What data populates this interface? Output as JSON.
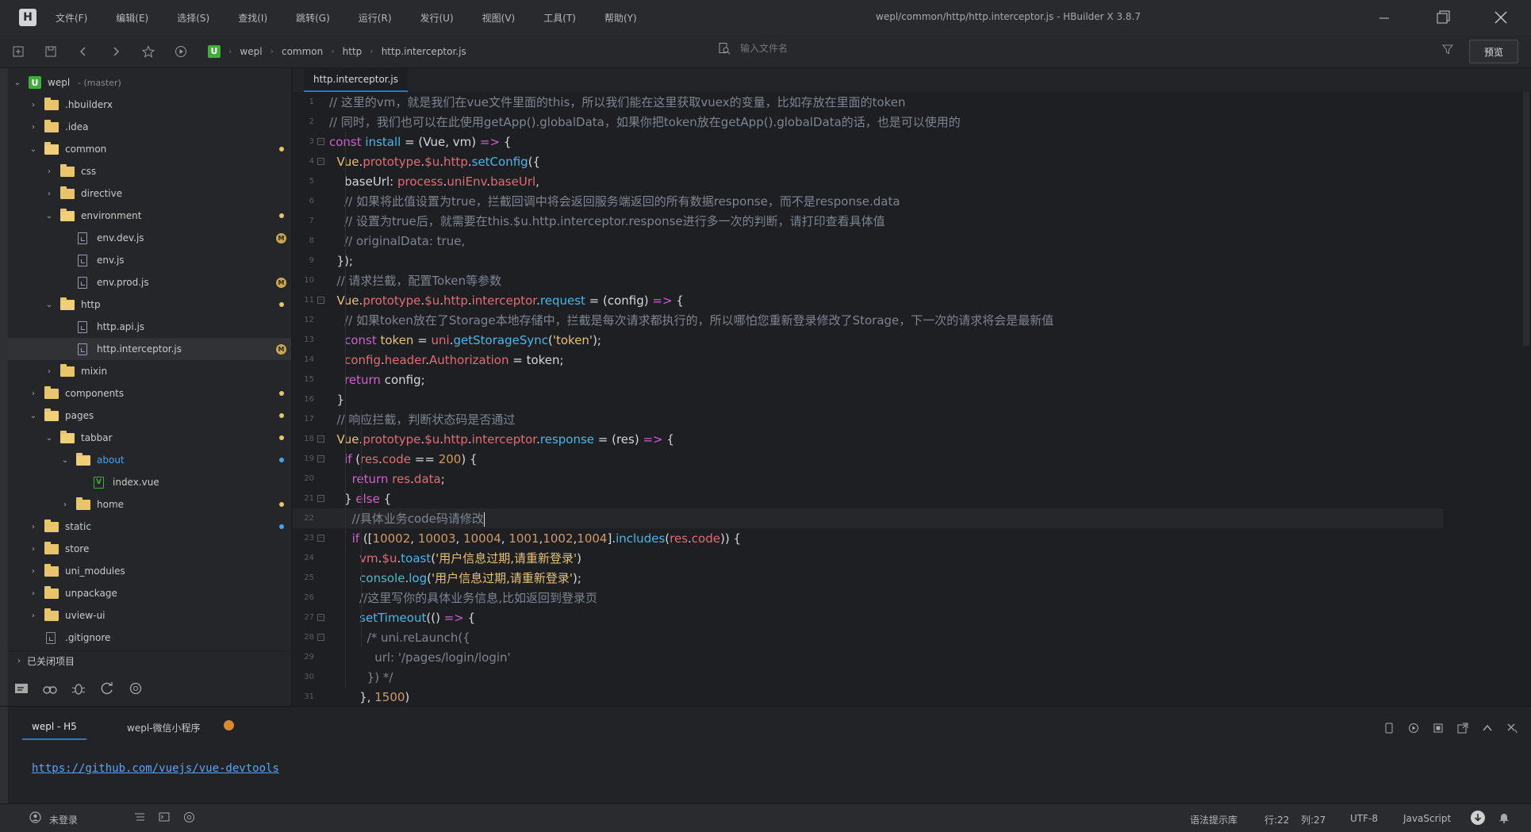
{
  "app": {
    "logo": "H",
    "window_title": "wepl/common/http/http.interceptor.js - HBuilder X 3.8.7"
  },
  "menu": [
    "文件(F)",
    "编辑(E)",
    "选择(S)",
    "查找(I)",
    "跳转(G)",
    "运行(R)",
    "发行(U)",
    "视图(V)",
    "工具(T)",
    "帮助(Y)"
  ],
  "toolbar": {
    "breadcrumb": [
      "wepl",
      "common",
      "http",
      "http.interceptor.js"
    ],
    "file_search_placeholder": "输入文件名",
    "preview_label": "预览"
  },
  "sidebar": {
    "project": {
      "name": "wepl",
      "branch": "- (master)"
    },
    "items": [
      {
        "label": ".hbuilderx",
        "type": "folder",
        "depth": 1,
        "expanded": false,
        "marker": ""
      },
      {
        "label": ".idea",
        "type": "folder",
        "depth": 1,
        "expanded": false,
        "marker": ""
      },
      {
        "label": "common",
        "type": "folder",
        "depth": 1,
        "expanded": true,
        "marker": "dot"
      },
      {
        "label": "css",
        "type": "folder",
        "depth": 2,
        "expanded": false,
        "marker": ""
      },
      {
        "label": "directive",
        "type": "folder",
        "depth": 2,
        "expanded": false,
        "marker": ""
      },
      {
        "label": "environment",
        "type": "folder",
        "depth": 2,
        "expanded": true,
        "marker": "dot"
      },
      {
        "label": "env.dev.js",
        "type": "js",
        "depth": 3,
        "marker": "M"
      },
      {
        "label": "env.js",
        "type": "js",
        "depth": 3,
        "marker": ""
      },
      {
        "label": "env.prod.js",
        "type": "js",
        "depth": 3,
        "marker": "M"
      },
      {
        "label": "http",
        "type": "folder",
        "depth": 2,
        "expanded": true,
        "marker": "dot"
      },
      {
        "label": "http.api.js",
        "type": "js",
        "depth": 3,
        "marker": ""
      },
      {
        "label": "http.interceptor.js",
        "type": "js",
        "depth": 3,
        "marker": "M",
        "selected": true
      },
      {
        "label": "mixin",
        "type": "folder",
        "depth": 2,
        "expanded": false,
        "marker": ""
      },
      {
        "label": "components",
        "type": "folder",
        "depth": 1,
        "expanded": false,
        "marker": "dot"
      },
      {
        "label": "pages",
        "type": "folder",
        "depth": 1,
        "expanded": true,
        "marker": "dot"
      },
      {
        "label": "tabbar",
        "type": "folder",
        "depth": 2,
        "expanded": true,
        "marker": "dot"
      },
      {
        "label": "about",
        "type": "folder",
        "depth": 3,
        "expanded": true,
        "marker": "dot-blue",
        "highlight": true
      },
      {
        "label": "index.vue",
        "type": "vue",
        "depth": 4,
        "marker": ""
      },
      {
        "label": "home",
        "type": "folder",
        "depth": 3,
        "expanded": false,
        "marker": "dot"
      },
      {
        "label": "static",
        "type": "folder",
        "depth": 1,
        "expanded": false,
        "marker": "dot-blue"
      },
      {
        "label": "store",
        "type": "folder",
        "depth": 1,
        "expanded": false,
        "marker": ""
      },
      {
        "label": "uni_modules",
        "type": "folder",
        "depth": 1,
        "expanded": false,
        "marker": ""
      },
      {
        "label": "unpackage",
        "type": "folder",
        "depth": 1,
        "expanded": false,
        "marker": ""
      },
      {
        "label": "uview-ui",
        "type": "folder",
        "depth": 1,
        "expanded": false,
        "marker": ""
      },
      {
        "label": ".gitignore",
        "type": "file",
        "depth": 1,
        "marker": ""
      }
    ],
    "closed_projects": "已关闭项目"
  },
  "editor": {
    "tab_label": "http.interceptor.js",
    "cursor_line": 22,
    "lines": [
      {
        "n": "1",
        "fold": false,
        "segs": [
          [
            "cm",
            "// 这里的vm，就是我们在vue文件里面的this，所以我们能在这里获取vuex的变量，比如存放在里面的token"
          ]
        ]
      },
      {
        "n": "2",
        "fold": false,
        "segs": [
          [
            "cm",
            "// 同时，我们也可以在此使用getApp().globalData，如果你把token放在getApp().globalData的话，也是可以使用的"
          ]
        ]
      },
      {
        "n": "3",
        "fold": true,
        "segs": [
          [
            "kw",
            "const "
          ],
          [
            "fn",
            "install"
          ],
          [
            "tx",
            " = (Vue, vm) "
          ],
          [
            "kw",
            "=>"
          ],
          [
            "tx",
            " {"
          ]
        ]
      },
      {
        "n": "4",
        "fold": true,
        "segs": [
          [
            "tx",
            "  "
          ],
          [
            "yl",
            "Vue"
          ],
          [
            "tx",
            "."
          ],
          [
            "pr",
            "prototype"
          ],
          [
            "tx",
            "."
          ],
          [
            "pr",
            "$u"
          ],
          [
            "tx",
            "."
          ],
          [
            "pr",
            "http"
          ],
          [
            "tx",
            "."
          ],
          [
            "fn",
            "setConfig"
          ],
          [
            "tx",
            "({"
          ]
        ]
      },
      {
        "n": "5",
        "fold": false,
        "segs": [
          [
            "tx",
            "    baseUrl: "
          ],
          [
            "pr",
            "process"
          ],
          [
            "tx",
            "."
          ],
          [
            "pr",
            "uniEnv"
          ],
          [
            "tx",
            "."
          ],
          [
            "pr",
            "baseUrl"
          ],
          [
            "tx",
            ","
          ]
        ]
      },
      {
        "n": "6",
        "fold": false,
        "segs": [
          [
            "cm",
            "    // 如果将此值设置为true，拦截回调中将会返回服务端返回的所有数据response，而不是response.data"
          ]
        ]
      },
      {
        "n": "7",
        "fold": false,
        "segs": [
          [
            "cm",
            "    // 设置为true后，就需要在this.$u.http.interceptor.response进行多一次的判断，请打印查看具体值"
          ]
        ]
      },
      {
        "n": "8",
        "fold": false,
        "segs": [
          [
            "cm",
            "    // originalData: true,"
          ]
        ]
      },
      {
        "n": "9",
        "fold": false,
        "segs": [
          [
            "tx",
            "  });"
          ]
        ]
      },
      {
        "n": "10",
        "fold": false,
        "segs": [
          [
            "cm",
            "  // 请求拦截，配置Token等参数"
          ]
        ]
      },
      {
        "n": "11",
        "fold": true,
        "segs": [
          [
            "tx",
            "  "
          ],
          [
            "yl",
            "Vue"
          ],
          [
            "tx",
            "."
          ],
          [
            "pr",
            "prototype"
          ],
          [
            "tx",
            "."
          ],
          [
            "pr",
            "$u"
          ],
          [
            "tx",
            "."
          ],
          [
            "pr",
            "http"
          ],
          [
            "tx",
            "."
          ],
          [
            "pr",
            "interceptor"
          ],
          [
            "tx",
            "."
          ],
          [
            "fn",
            "request"
          ],
          [
            "tx",
            " = (config) "
          ],
          [
            "kw",
            "=>"
          ],
          [
            "tx",
            " {"
          ]
        ]
      },
      {
        "n": "12",
        "fold": false,
        "segs": [
          [
            "cm",
            "    // 如果token放在了Storage本地存储中，拦截是每次请求都执行的，所以哪怕您重新登录修改了Storage，下一次的请求将会是最新值"
          ]
        ]
      },
      {
        "n": "13",
        "fold": false,
        "segs": [
          [
            "tx",
            "    "
          ],
          [
            "kw",
            "const "
          ],
          [
            "yl",
            "token"
          ],
          [
            "tx",
            " = "
          ],
          [
            "pr",
            "uni"
          ],
          [
            "tx",
            "."
          ],
          [
            "fn",
            "getStorageSync"
          ],
          [
            "tx",
            "("
          ],
          [
            "st",
            "'token'"
          ],
          [
            "tx",
            ");"
          ]
        ]
      },
      {
        "n": "14",
        "fold": false,
        "segs": [
          [
            "tx",
            "    "
          ],
          [
            "pr",
            "config"
          ],
          [
            "tx",
            "."
          ],
          [
            "pr",
            "header"
          ],
          [
            "tx",
            "."
          ],
          [
            "pr",
            "Authorization"
          ],
          [
            "tx",
            " = token;"
          ]
        ]
      },
      {
        "n": "15",
        "fold": false,
        "segs": [
          [
            "tx",
            "    "
          ],
          [
            "kw",
            "return "
          ],
          [
            "tx",
            "config;"
          ]
        ]
      },
      {
        "n": "16",
        "fold": false,
        "segs": [
          [
            "tx",
            "  }"
          ]
        ]
      },
      {
        "n": "17",
        "fold": false,
        "segs": [
          [
            "cm",
            "  // 响应拦截，判断状态码是否通过"
          ]
        ]
      },
      {
        "n": "18",
        "fold": true,
        "segs": [
          [
            "tx",
            "  "
          ],
          [
            "yl",
            "Vue"
          ],
          [
            "tx",
            "."
          ],
          [
            "pr",
            "prototype"
          ],
          [
            "tx",
            "."
          ],
          [
            "pr",
            "$u"
          ],
          [
            "tx",
            "."
          ],
          [
            "pr",
            "http"
          ],
          [
            "tx",
            "."
          ],
          [
            "pr",
            "interceptor"
          ],
          [
            "tx",
            "."
          ],
          [
            "fn",
            "response"
          ],
          [
            "tx",
            " = (res) "
          ],
          [
            "kw",
            "=>"
          ],
          [
            "tx",
            " {"
          ]
        ]
      },
      {
        "n": "19",
        "fold": true,
        "segs": [
          [
            "tx",
            "    "
          ],
          [
            "kw",
            "if"
          ],
          [
            "tx",
            " ("
          ],
          [
            "pr",
            "res"
          ],
          [
            "tx",
            "."
          ],
          [
            "pr",
            "code"
          ],
          [
            "tx",
            " == "
          ],
          [
            "nm",
            "200"
          ],
          [
            "tx",
            ") {"
          ]
        ]
      },
      {
        "n": "20",
        "fold": false,
        "segs": [
          [
            "tx",
            "      "
          ],
          [
            "kw",
            "return "
          ],
          [
            "pr",
            "res"
          ],
          [
            "tx",
            "."
          ],
          [
            "pr",
            "data"
          ],
          [
            "tx",
            ";"
          ]
        ]
      },
      {
        "n": "21",
        "fold": true,
        "segs": [
          [
            "tx",
            "    } "
          ],
          [
            "kw",
            "else"
          ],
          [
            "tx",
            " {"
          ]
        ]
      },
      {
        "n": "22",
        "fold": false,
        "segs": [
          [
            "cm",
            "      //具体业务code码请修改"
          ]
        ],
        "cursor": true
      },
      {
        "n": "23",
        "fold": true,
        "segs": [
          [
            "tx",
            "      "
          ],
          [
            "kw",
            "if"
          ],
          [
            "tx",
            " (["
          ],
          [
            "nm",
            "10002"
          ],
          [
            "tx",
            ", "
          ],
          [
            "nm",
            "10003"
          ],
          [
            "tx",
            ", "
          ],
          [
            "nm",
            "10004"
          ],
          [
            "tx",
            ", "
          ],
          [
            "nm",
            "1001"
          ],
          [
            "tx",
            ","
          ],
          [
            "nm",
            "1002"
          ],
          [
            "tx",
            ","
          ],
          [
            "nm",
            "1004"
          ],
          [
            "tx",
            "]."
          ],
          [
            "fn",
            "includes"
          ],
          [
            "tx",
            "("
          ],
          [
            "pr",
            "res"
          ],
          [
            "tx",
            "."
          ],
          [
            "pr",
            "code"
          ],
          [
            "tx",
            ")) {"
          ]
        ]
      },
      {
        "n": "24",
        "fold": false,
        "segs": [
          [
            "tx",
            "        "
          ],
          [
            "pr",
            "vm"
          ],
          [
            "tx",
            "."
          ],
          [
            "pr",
            "$u"
          ],
          [
            "tx",
            "."
          ],
          [
            "fn",
            "toast"
          ],
          [
            "tx",
            "("
          ],
          [
            "st",
            "'用户信息过期,请重新登录'"
          ],
          [
            "tx",
            ")"
          ]
        ]
      },
      {
        "n": "25",
        "fold": false,
        "segs": [
          [
            "tx",
            "        "
          ],
          [
            "bl",
            "console"
          ],
          [
            "tx",
            "."
          ],
          [
            "fn",
            "log"
          ],
          [
            "tx",
            "("
          ],
          [
            "st",
            "'用户信息过期,请重新登录'"
          ],
          [
            "tx",
            ");"
          ]
        ]
      },
      {
        "n": "26",
        "fold": false,
        "segs": [
          [
            "cm",
            "        //这里写你的具体业务信息,比如返回到登录页"
          ]
        ]
      },
      {
        "n": "27",
        "fold": true,
        "segs": [
          [
            "tx",
            "        "
          ],
          [
            "fn",
            "setTimeout"
          ],
          [
            "tx",
            "(() "
          ],
          [
            "kw",
            "=>"
          ],
          [
            "tx",
            " {"
          ]
        ]
      },
      {
        "n": "28",
        "fold": true,
        "segs": [
          [
            "cm",
            "          /* uni.reLaunch({"
          ]
        ]
      },
      {
        "n": "29",
        "fold": false,
        "segs": [
          [
            "cm",
            "            url: '/pages/login/login'"
          ]
        ]
      },
      {
        "n": "30",
        "fold": false,
        "segs": [
          [
            "cm",
            "          }) */"
          ]
        ]
      },
      {
        "n": "31",
        "fold": false,
        "segs": [
          [
            "tx",
            "        }, "
          ],
          [
            "nm",
            "1500"
          ],
          [
            "tx",
            ")"
          ]
        ]
      }
    ]
  },
  "console": {
    "tabs": [
      "wepl - H5",
      "wepl-微信小程序"
    ],
    "output_link": "https://github.com/vuejs/vue-devtools"
  },
  "statusbar": {
    "login": "未登录",
    "syntax_lib": "语法提示库",
    "line": "行:22",
    "column": "列:27",
    "encoding": "UTF-8",
    "language": "JavaScript"
  }
}
